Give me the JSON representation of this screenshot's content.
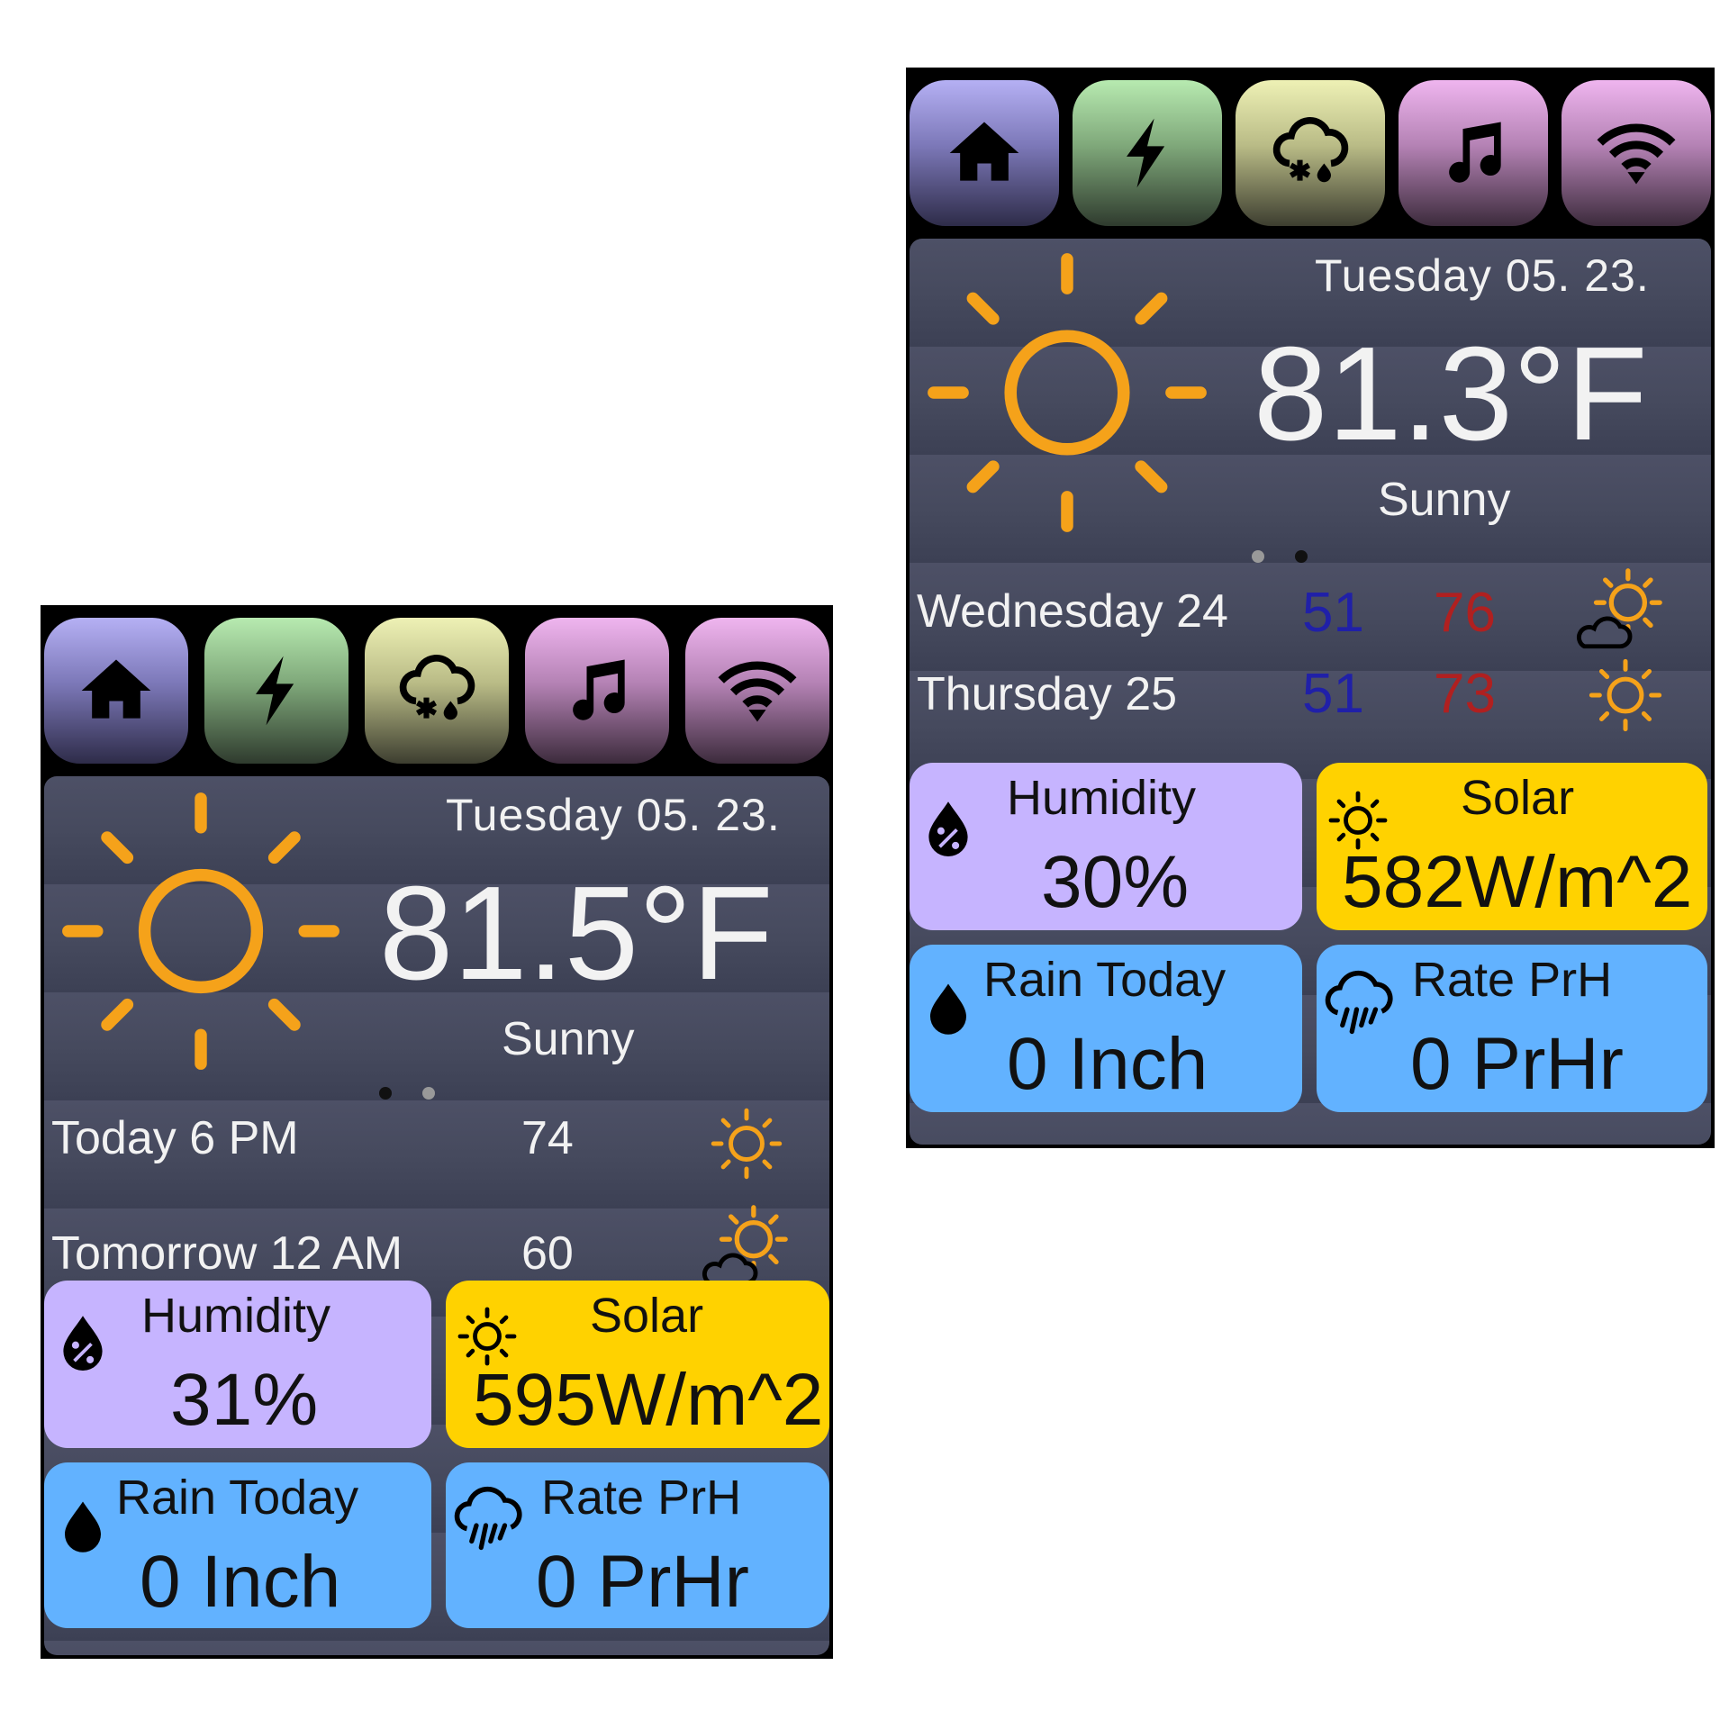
{
  "tabs": [
    {
      "name": "home",
      "icon": "home-icon"
    },
    {
      "name": "power",
      "icon": "lightning-icon"
    },
    {
      "name": "weather",
      "icon": "snow-cloud-icon"
    },
    {
      "name": "music",
      "icon": "music-note-icon"
    },
    {
      "name": "wifi",
      "icon": "wifi-icon"
    }
  ],
  "screens": [
    {
      "date": "Tuesday 05. 23.",
      "temperature": "81.5°F",
      "condition": "Sunny",
      "page_indicator": {
        "count": 2,
        "active": 0
      },
      "forecast": [
        {
          "label": "Today 6 PM",
          "temp": "74",
          "icon": "sun-icon"
        },
        {
          "label": "Tomorrow 12 AM",
          "temp": "60",
          "icon": "sun-cloud-icon"
        }
      ],
      "tiles": {
        "humidity": {
          "label": "Humidity",
          "value": "31%"
        },
        "solar": {
          "label": "Solar",
          "value": "595W/m^2"
        },
        "rain_today": {
          "label": "Rain Today",
          "value": "0 Inch"
        },
        "rate": {
          "label": "Rate PrH",
          "value": "0 PrHr"
        }
      }
    },
    {
      "date": "Tuesday 05. 23.",
      "temperature": "81.3°F",
      "condition": "Sunny",
      "page_indicator": {
        "count": 2,
        "active": 1
      },
      "forecast": [
        {
          "label": "Wednesday 24",
          "low": "51",
          "high": "76",
          "icon": "sun-cloud-icon"
        },
        {
          "label": "Thursday 25",
          "low": "51",
          "high": "73",
          "icon": "sun-icon"
        }
      ],
      "tiles": {
        "humidity": {
          "label": "Humidity",
          "value": "30%"
        },
        "solar": {
          "label": "Solar",
          "value": "582W/m^2"
        },
        "rain_today": {
          "label": "Rain Today",
          "value": "0 Inch"
        },
        "rate": {
          "label": "Rate PrH",
          "value": "0 PrHr"
        }
      }
    }
  ],
  "colors": {
    "sun": "#f5a21a",
    "humidity_tile": "#c6b4ff",
    "solar_tile": "#ffd200",
    "rain_tile": "#62b2ff",
    "low_temp": "#2020a8",
    "high_temp": "#b02020"
  }
}
